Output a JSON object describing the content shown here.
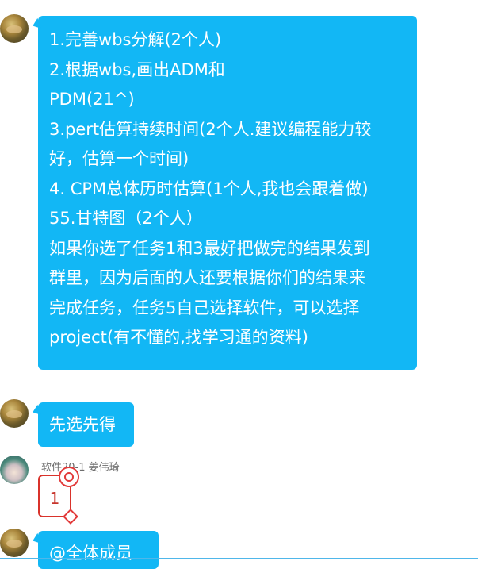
{
  "chat": {
    "messages": [
      {
        "sender": "",
        "lines": [
          "1.完善wbs分解(2个人)",
          "2.根据wbs,画出ADM和",
          "PDM(21^)",
          "3.pert估算持续时间(2个人.建议编程能力较",
          "好，估算一个时间)",
          "4. CPM总体历时估算(1个人,我也会跟着做)",
          "55.甘特图（2个人）",
          "如果你选了任务1和3最好把做完的结果发到",
          "群里，因为后面的人还要根据你们的结果来",
          "完成任务，任务5自己选择软件，可以选择",
          "project(有不懂的,找学习通的资料)"
        ]
      },
      {
        "sender": "",
        "text": "先选先得"
      },
      {
        "sender": "软件20-1 姜伟琦",
        "sticker_text": "1"
      },
      {
        "sender": "",
        "text": "@全体成员"
      }
    ]
  },
  "colors": {
    "bubble_bg": "#12b7f5",
    "bubble_text": "#ffffff",
    "sender_text": "#6d6d6d",
    "sticker_accent": "#d9332b"
  },
  "icons": {
    "avatar_1": "food-avatar-icon",
    "avatar_2": "anime-avatar-icon",
    "sticker": "number-one-sticker-icon"
  }
}
